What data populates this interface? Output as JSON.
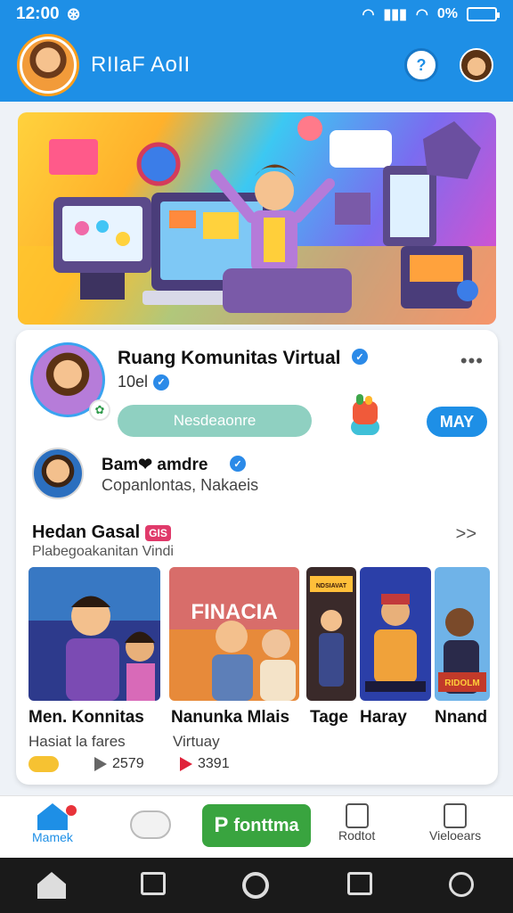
{
  "status_bar": {
    "time": "12:00",
    "battery": "0%"
  },
  "header": {
    "title": "RIIaF AoII"
  },
  "community": {
    "name": "Ruang Komunitas Virtual",
    "subtitle": "10el",
    "primary_button": "Nesdeaonre",
    "secondary_button": "MAY"
  },
  "user": {
    "name": "Bam❤ amdre",
    "subtitle": "Copanlontas, Nakaeis"
  },
  "section": {
    "title": "Hedan Gasal",
    "badge": "GIS",
    "subtitle": "Plabegoakanitan Vindi",
    "arrow": ">>"
  },
  "videos": [
    {
      "title": "Men. Konnitas",
      "subtitle": "Hasiat la fares"
    },
    {
      "title": "Nanunka Mlais",
      "subtitle": "Virtuay"
    },
    {
      "title": "Tage"
    },
    {
      "title": "Haray"
    },
    {
      "title": "Nnand"
    }
  ],
  "thumbnail_texts": {
    "v2_overlay": "FINACIA",
    "v3_overlay": "NDSIAVAT",
    "v5_overlay": "RIDOLM"
  },
  "stats": [
    {
      "icon": "heart-icon",
      "value": ""
    },
    {
      "icon": "like-icon",
      "value": "2579"
    },
    {
      "icon": "play-icon",
      "value": "3391"
    }
  ],
  "bottom_nav": {
    "home_label": "Mamek",
    "promo_label": "fonttma",
    "promo_prefix": "P",
    "rocket_label": "Rodtot",
    "videos_label": "Vieloears"
  },
  "colors": {
    "primary": "#1e8fe6",
    "success": "#39a43f",
    "accent_teal": "#8fd0c1"
  }
}
